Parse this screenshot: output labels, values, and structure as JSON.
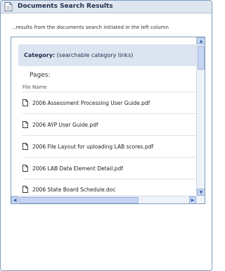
{
  "header": {
    "title": "Documents Search Results",
    "icon": "document-icon"
  },
  "subtitle": "...results from the documents search initiated in the left column",
  "category": {
    "label": "Category:",
    "text": "(searchable category links)"
  },
  "pages_label": "Pages:",
  "column_header": "File Name",
  "files": [
    {
      "name": "2006 Assessment Processing User Guide.pdf"
    },
    {
      "name": "2006 AYP User Guide.pdf"
    },
    {
      "name": "2006 File Layout for uploading LAB scores.pdf"
    },
    {
      "name": "2006 LAB Data Element Detail.pdf"
    },
    {
      "name": "2006 State Board Schedule.doc"
    }
  ],
  "colors": {
    "header_bg": "#dfe6f0",
    "category_bg": "#dde4f1",
    "border": "#7f9db9",
    "scrollbar": "#c6d6f2"
  }
}
